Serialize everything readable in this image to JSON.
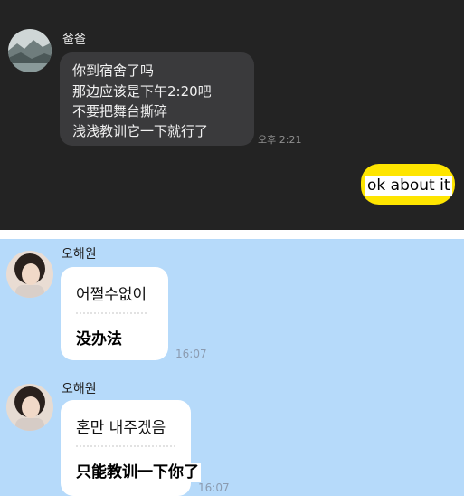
{
  "dad_chat": {
    "sender": "爸爸",
    "lines": [
      "你到宿舍了吗",
      "那边应该是下午2:20吧",
      "不要把舞台撕碎",
      "浅浅教训它一下就行了"
    ],
    "time": "오후 2:21",
    "reply": "ok about it"
  },
  "idol_chat": {
    "messages": [
      {
        "sender": "오해원",
        "text": "어쩔수없이",
        "subtitle": "没办法",
        "time": "16:07"
      },
      {
        "sender": "오해원",
        "text": "혼만 내주겠음",
        "subtitle": "只能教训一下你了",
        "time": "16:07"
      }
    ]
  },
  "colors": {
    "dark_bg": "#232323",
    "dark_bubble": "#3a3a3c",
    "my_bubble": "#fee500",
    "light_bg": "#b6dafa",
    "light_bubble": "#ffffff"
  },
  "icons": [
    "dad-avatar",
    "oh-haewon-avatar"
  ]
}
